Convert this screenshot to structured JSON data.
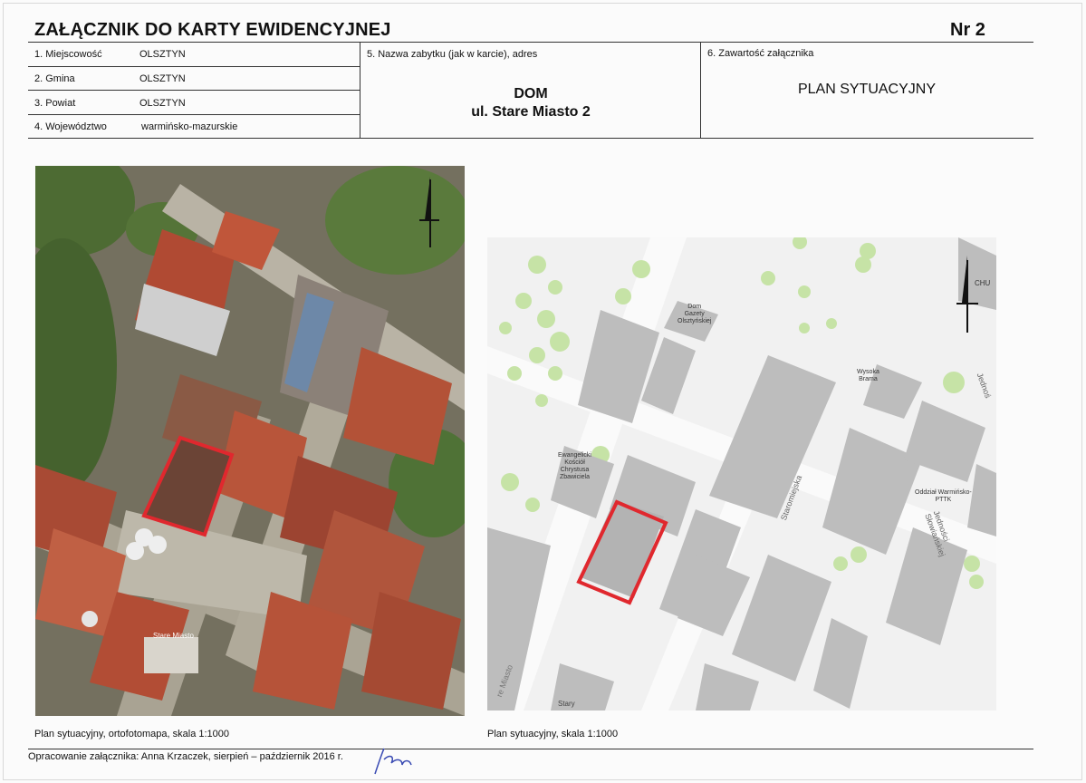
{
  "header": {
    "title": "ZAŁĄCZNIK DO KARTY EWIDENCYJNEJ",
    "number": "Nr 2"
  },
  "fields": [
    {
      "label": "1. Miejscowość",
      "value": "OLSZTYN"
    },
    {
      "label": "2. Gmina",
      "value": "OLSZTYN"
    },
    {
      "label": "3. Powiat",
      "value": "OLSZTYN"
    },
    {
      "label": "4. Województwo",
      "value": "warmińsko-mazurskie"
    }
  ],
  "monument": {
    "label": "5. Nazwa zabytku (jak w karcie), adres",
    "name": "DOM",
    "address": "ul. Stare Miasto 2"
  },
  "attachment": {
    "label": "6. Zawartość załącznika",
    "content": "PLAN SYTUACYJNY"
  },
  "photo_map": {
    "caption": "Plan sytuacyjny, ortofotomapa,  skala 1:1000",
    "place_label": "Stare Miasto"
  },
  "street_map": {
    "caption": "Plan sytuacyjny, skala 1:1000",
    "labels": {
      "dom_gazety": [
        "Dom",
        "Gazety",
        "Olsztyńskiej"
      ],
      "brama": [
        "Wysoka",
        "Brama"
      ],
      "kosciol": [
        "Ewangelicki",
        "Kościół",
        "Chrystusa",
        "Zbawiciela"
      ],
      "staromiejska": "Staromiejska",
      "jednosci1": "Jedności Słowiańskiej",
      "jednosci2": "Jednoś",
      "pttk": [
        "Oddział Warmińsko-",
        "PTTK"
      ],
      "chu": "CHU",
      "stary": "Stary",
      "stare_miasto": "re Miasto"
    }
  },
  "footer": {
    "prepared_by": "Opracowanie załącznika: Anna Krzaczek, sierpień – październik 2016 r."
  },
  "colors": {
    "highlight": "#e0282e",
    "building": "#bdbdbd",
    "tree": "#c6e3a6"
  }
}
